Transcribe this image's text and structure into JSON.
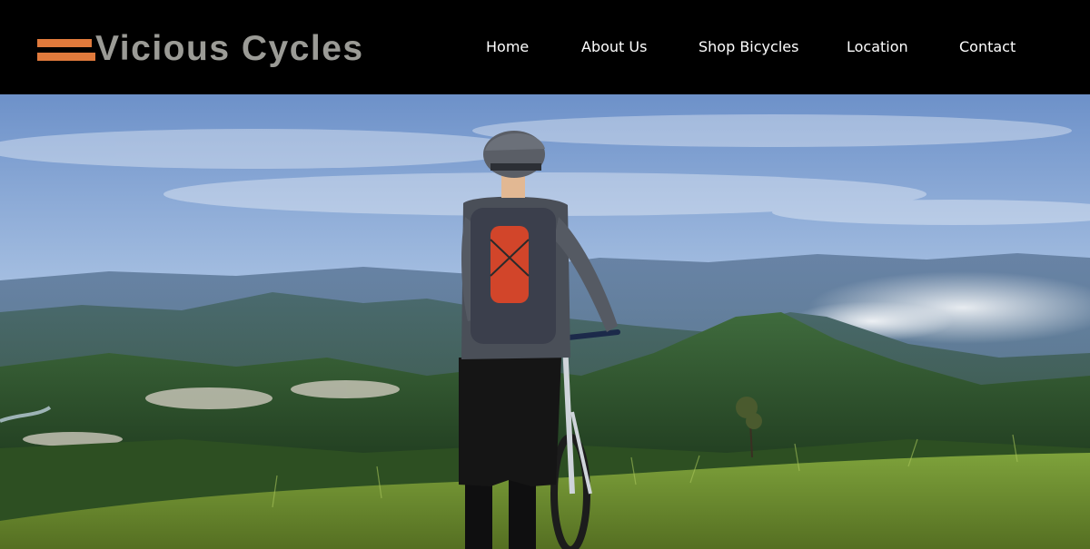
{
  "brand": {
    "name": "Vicious Cycles",
    "accent": "#e07a3c",
    "text_color": "#9b9b96"
  },
  "nav": {
    "items": [
      {
        "label": "Home"
      },
      {
        "label": "About Us"
      },
      {
        "label": "Shop Bicycles"
      },
      {
        "label": "Location"
      },
      {
        "label": "Contact"
      }
    ]
  },
  "hero": {
    "image": "cyclist-overlooking-mountain-valley"
  }
}
